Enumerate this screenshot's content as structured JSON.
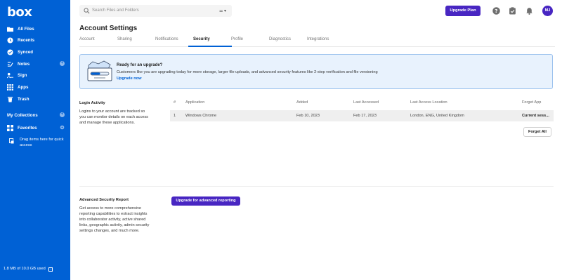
{
  "app": {
    "logo": "box"
  },
  "sidebar": {
    "items": [
      {
        "label": "All Files",
        "icon": "folder-icon"
      },
      {
        "label": "Recents",
        "icon": "clock-icon"
      },
      {
        "label": "Synced",
        "icon": "check-circle-icon"
      },
      {
        "label": "Notes",
        "icon": "notes-icon"
      },
      {
        "label": "Sign",
        "icon": "sign-icon"
      },
      {
        "label": "Apps",
        "icon": "grid-icon"
      },
      {
        "label": "Trash",
        "icon": "trash-icon"
      }
    ],
    "collections_label": "My Collections",
    "favorites_label": "Favorites",
    "quick_access_text": "Drag items here for quick access",
    "storage_text": "1.8 MB of 10.0 GB used"
  },
  "topbar": {
    "search_placeholder": "Search Files and Folders",
    "filter_label": "⚌ ▾",
    "upgrade_plan_label": "Upgrade Plan",
    "avatar_initials": "MJ"
  },
  "page": {
    "title": "Account Settings",
    "tabs": [
      "Account",
      "Sharing",
      "Notifications",
      "Security",
      "Profile",
      "Diagnostics",
      "Integrations"
    ],
    "active_tab": "Security"
  },
  "banner": {
    "title": "Ready for an upgrade?",
    "body": "Customers like you are upgrading today for more storage, larger file uploads, and advanced security features like 2-step verification and file versioning",
    "link": "Upgrade now"
  },
  "login_activity": {
    "title": "Login Activity",
    "description": "Logins to your account are tracked so you can monitor details on each access and manage these applications.",
    "columns": [
      "#",
      "Application",
      "Added",
      "Last Accessed",
      "Last Access Location",
      "Forget App"
    ],
    "rows": [
      {
        "num": "1",
        "application": "Windows Chrome",
        "added": "Feb 10, 2023",
        "last_accessed": "Feb 17, 2023",
        "location": "London, ENG, United Kingdom",
        "forget": "Current sess..."
      }
    ],
    "forget_all_label": "Forget All"
  },
  "advanced_report": {
    "title": "Advanced Security Report",
    "description": "Get access to more comprehensive reporting capabilities to extract insights into collaborator activity, active shared links, geographic activity, admin security settings changes, and much more.",
    "button_label": "Upgrade for advanced reporting"
  },
  "colors": {
    "sidebar_bg": "#0061d5",
    "accent_purple": "#4826c2",
    "banner_bg": "#e8f2fd"
  }
}
